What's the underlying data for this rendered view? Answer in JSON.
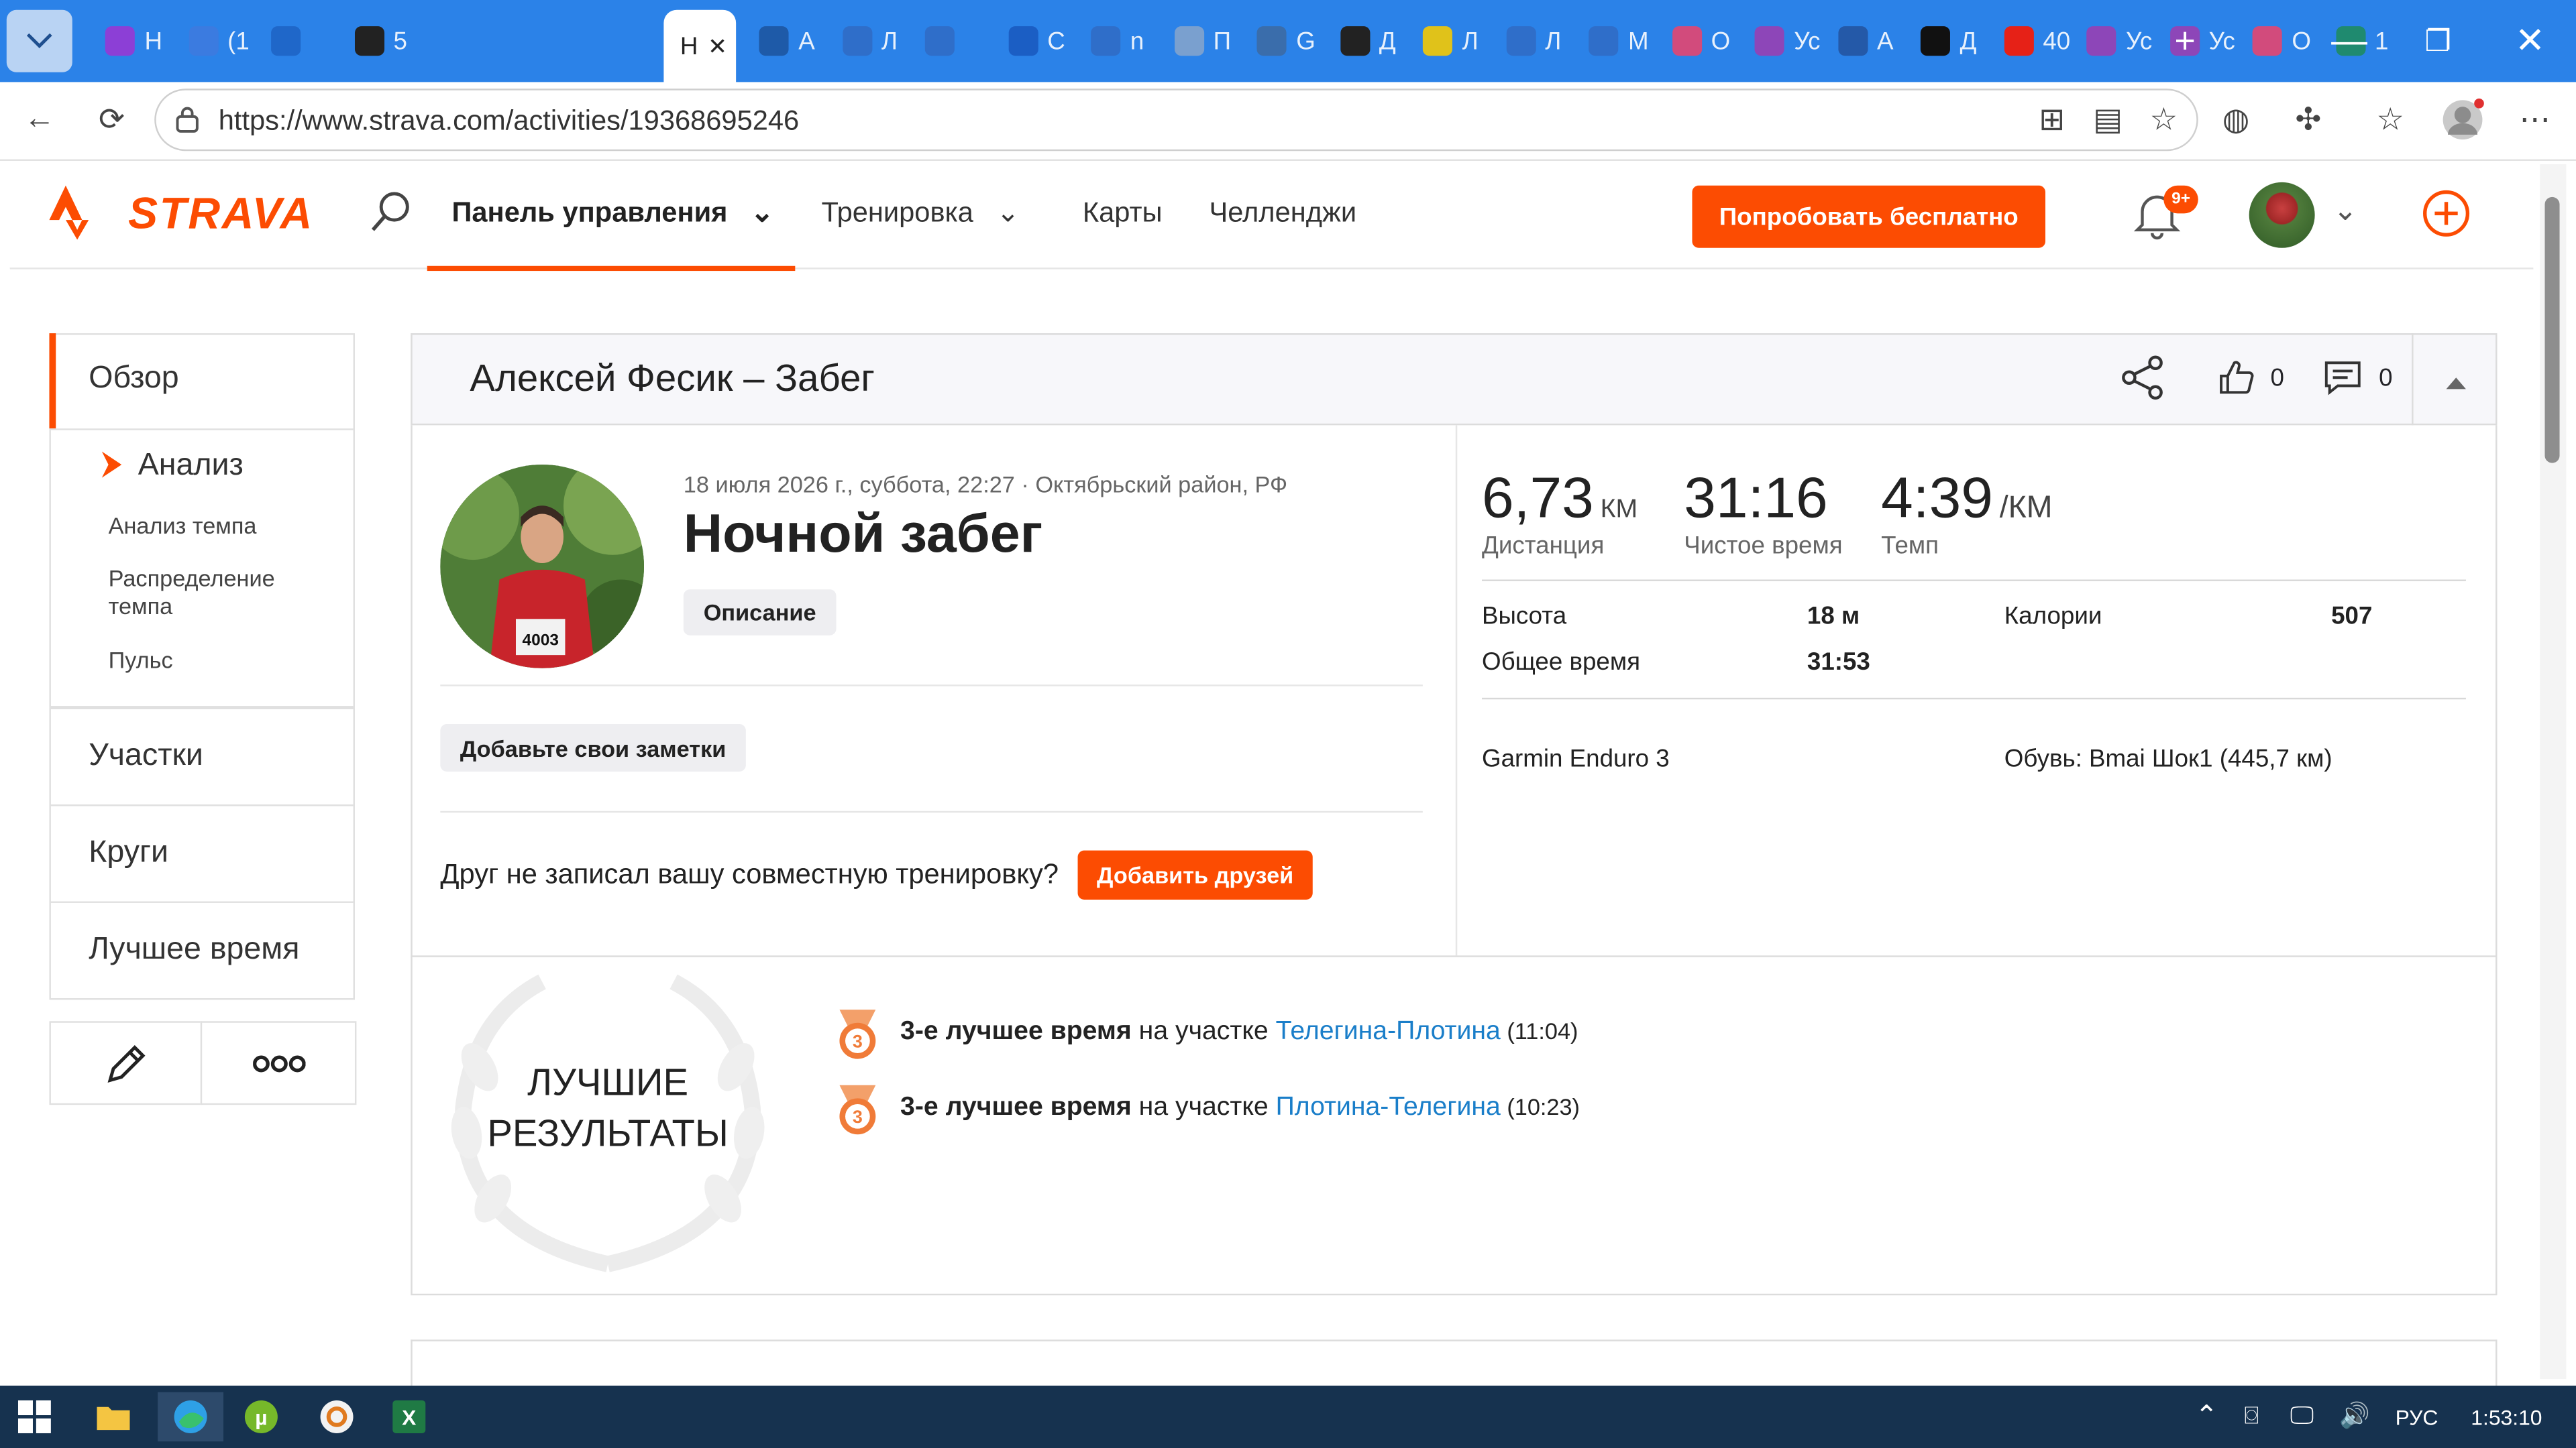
{
  "browser": {
    "tabs": [
      {
        "text": "Н",
        "color": "#8c3fd6"
      },
      {
        "text": "(1",
        "color": "#3b7be0"
      },
      {
        "text": "",
        "color": "#1f67c9"
      },
      {
        "text": "5",
        "color": "#222222"
      },
      {
        "text": "А",
        "color": "#1e5aa8"
      },
      {
        "text": "Л",
        "color": "#2f6ec9"
      },
      {
        "text": "",
        "color": "#2f6ec9"
      },
      {
        "text": "С",
        "color": "#1b5ec4"
      },
      {
        "text": "n",
        "color": "#2f6ec9"
      },
      {
        "text": "П",
        "color": "#7aa0cf"
      },
      {
        "text": "G",
        "color": "#3a6dab"
      },
      {
        "text": "Д",
        "color": "#222222"
      },
      {
        "text": "Л",
        "color": "#e0c21a"
      },
      {
        "text": "Л",
        "color": "#2f6ec9"
      },
      {
        "text": "М",
        "color": "#2f6ec9"
      },
      {
        "text": "О",
        "color": "#d24b7c"
      },
      {
        "text": "Ус",
        "color": "#8d46b8"
      },
      {
        "text": "А",
        "color": "#2459a8"
      },
      {
        "text": "Д",
        "color": "#111111"
      },
      {
        "text": "40",
        "color": "#e62117"
      },
      {
        "text": "Ус",
        "color": "#8d46b8"
      },
      {
        "text": "Ус",
        "color": "#8d46b8"
      },
      {
        "text": "О",
        "color": "#d24b7c"
      },
      {
        "text": "1",
        "color": "#1f8a6f"
      }
    ],
    "active_tab": "Н",
    "url": "https://www.strava.com/activities/19368695246"
  },
  "header": {
    "logo": "STRAVA",
    "nav": [
      "Панель управления",
      "Тренировка",
      "Карты",
      "Челленджи"
    ],
    "try_button": "Попробовать бесплатно",
    "notif_badge": "9+"
  },
  "sidebar": {
    "overview": "Обзор",
    "analysis": "Анализ",
    "sub": [
      "Анализ темпа",
      "Распределение темпа",
      "Пульс"
    ],
    "segments": "Участки",
    "laps": "Круги",
    "best": "Лучшее время"
  },
  "activity": {
    "heading": "Алексей Фесик – Забег",
    "kudos": "0",
    "comments": "0",
    "meta": "18 июля 2026 г., суббота, 22:27 · Октябрьский район, РФ",
    "title": "Ночной забег",
    "description_btn": "Описание",
    "notes_btn": "Добавьте свои заметки",
    "friend_text": "Друг не записал вашу совместную тренировку?",
    "add_friends_btn": "Добавить друзей",
    "bib": "4003"
  },
  "stats": {
    "distance": {
      "value": "6,73",
      "unit": "КМ",
      "label": "Дистанция"
    },
    "moving": {
      "value": "31:16",
      "label": "Чистое время"
    },
    "pace": {
      "value": "4:39",
      "unit": "/КМ",
      "label": "Темп"
    },
    "elevation_label": "Высота",
    "elevation": "18 м",
    "calories_label": "Калории",
    "calories": "507",
    "elapsed_label": "Общее время",
    "elapsed": "31:53",
    "device": "Garmin Enduro 3",
    "shoes": "Обувь: Bmai Шок1 (445,7 км)"
  },
  "results": {
    "badge_line1": "ЛУЧШИЕ",
    "badge_line2": "РЕЗУЛЬТАТЫ",
    "items": [
      {
        "rank": "3",
        "bold": "3-е лучшее время",
        "mid": " на участке ",
        "segment": "Телегина-Плотина",
        "time": " (11:04)"
      },
      {
        "rank": "3",
        "bold": "3-е лучшее время",
        "mid": " на участке ",
        "segment": "Плотина-Телегина",
        "time": " (10:23)"
      }
    ]
  },
  "taskbar": {
    "lang": "РУС",
    "time": "1:53:10"
  },
  "colors": {
    "accent": "#fc4c02",
    "link": "#1a7ec9",
    "tabbar": "#2b82e8"
  }
}
